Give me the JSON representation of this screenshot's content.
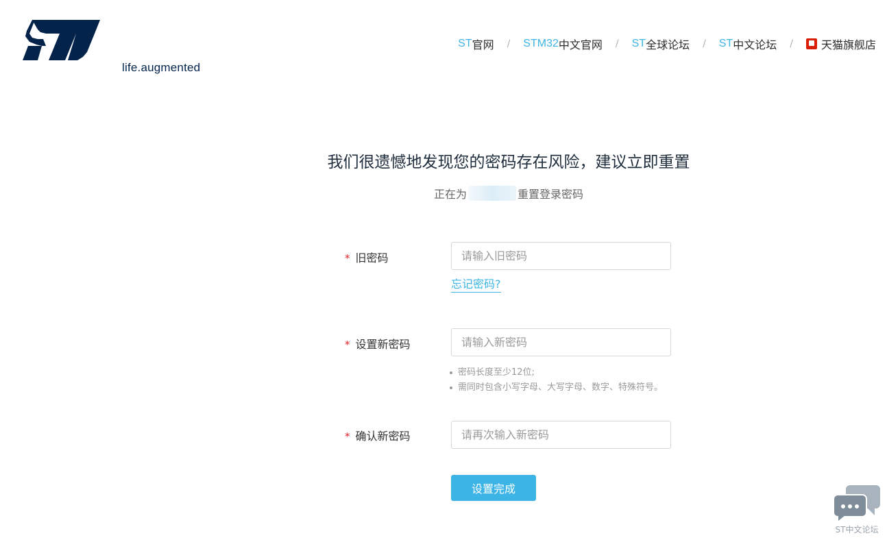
{
  "brand": {
    "tagline": "life.augmented",
    "logo_icon": "st-logo"
  },
  "nav": {
    "items": [
      {
        "prefix": "ST",
        "label": "官网"
      },
      {
        "prefix": "STM32",
        "label": "中文官网"
      },
      {
        "prefix": "ST",
        "label": "全球论坛"
      },
      {
        "prefix": "ST",
        "label": "中文论坛"
      },
      {
        "prefix": "",
        "label": "天猫旗舰店",
        "icon": "tmall-icon"
      }
    ],
    "separator": "/"
  },
  "page": {
    "headline": "我们很遗憾地发现您的密码存在风险，建议立即重置",
    "sub_prefix": "正在为",
    "sub_suffix": "重置登录密码"
  },
  "form": {
    "required_mark": "*",
    "old_password": {
      "label": "旧密码",
      "placeholder": "请输入旧密码",
      "value": ""
    },
    "forgot_link": "忘记密码?",
    "new_password": {
      "label": "设置新密码",
      "placeholder": "请输入新密码",
      "value": ""
    },
    "hints": [
      "密码长度至少12位;",
      "需同时包含小写字母、大写字母、数字、特殊符号。"
    ],
    "confirm_password": {
      "label": "确认新密码",
      "placeholder": "请再次输入新密码",
      "value": ""
    },
    "submit_label": "设置完成"
  },
  "widget": {
    "label": "ST中文论坛",
    "icon": "chat-bubbles-icon"
  },
  "colors": {
    "accent": "#3cb4e6",
    "brand_navy": "#03234b",
    "required": "#e0262b",
    "tmall_red": "#d81e06"
  }
}
